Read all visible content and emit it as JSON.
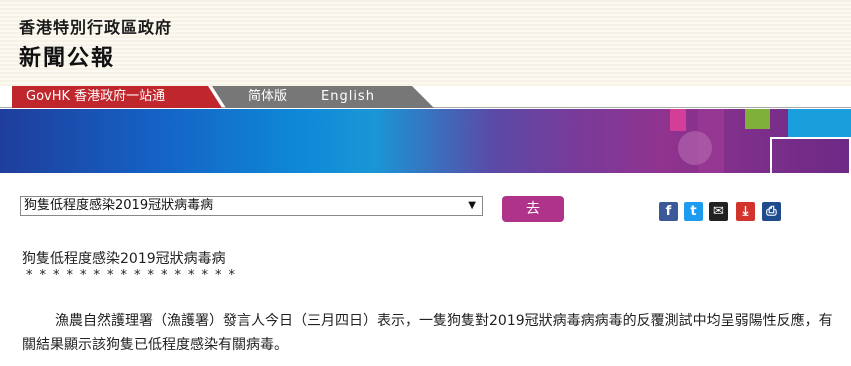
{
  "header": {
    "org_name": "香港特別行政區政府",
    "publication": "新聞公報"
  },
  "nav": {
    "govhk": "GovHK 香港政府一站通",
    "simplified": "简体版",
    "english": "English"
  },
  "selector": {
    "selected": "狗隻低程度感染2019冠狀病毒病",
    "arrow": "▼",
    "go_label": "去"
  },
  "share": {
    "facebook": "f",
    "twitter": "t",
    "email": "✉",
    "save": "⤓",
    "print": "⎙"
  },
  "article": {
    "title": "狗隻低程度感染2019冠狀病毒病",
    "separator": "****************",
    "body": "漁農自然護理署（漁護署）發言人今日（三月四日）表示，一隻狗隻對2019冠狀病毒病病毒的反覆測試中均呈弱陽性反應，有關結果顯示該狗隻已低程度感染有關病毒。"
  }
}
